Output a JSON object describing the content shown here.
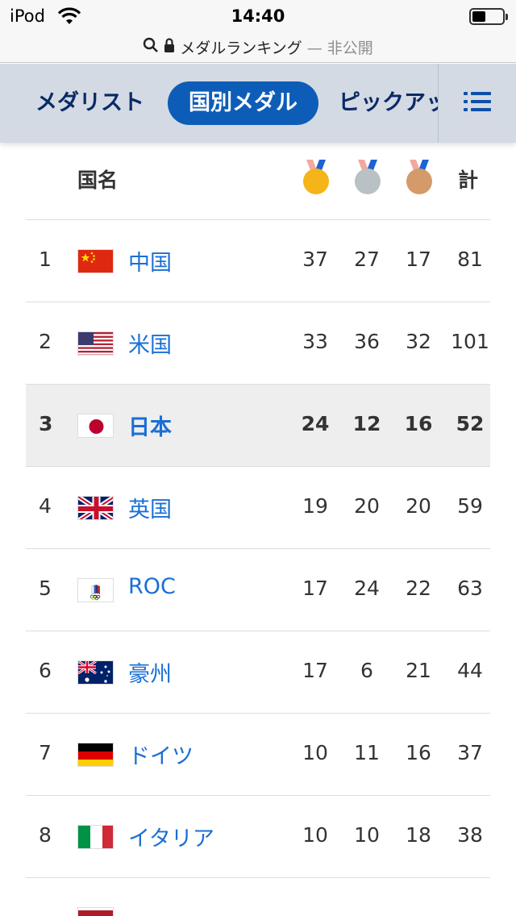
{
  "status_bar": {
    "carrier": "iPod",
    "time": "14:40"
  },
  "url_bar": {
    "title": "メダルランキング",
    "suffix": "— 非公開"
  },
  "tabs": [
    {
      "label": "メダリスト",
      "active": false
    },
    {
      "label": "国別メダル",
      "active": true
    },
    {
      "label": "ピックアップ",
      "active": false
    }
  ],
  "table": {
    "country_header": "国名",
    "total_header": "計",
    "medal_icons": [
      "gold-medal-icon",
      "silver-medal-icon",
      "bronze-medal-icon"
    ],
    "highlight_color": "#eeeeee",
    "link_color": "#1a6fd4",
    "rows": [
      {
        "rank": "1",
        "country": "中国",
        "flag": "china-flag-icon",
        "gold": "37",
        "silver": "27",
        "bronze": "17",
        "total": "81"
      },
      {
        "rank": "2",
        "country": "米国",
        "flag": "usa-flag-icon",
        "gold": "33",
        "silver": "36",
        "bronze": "32",
        "total": "101"
      },
      {
        "rank": "3",
        "country": "日本",
        "flag": "japan-flag-icon",
        "gold": "24",
        "silver": "12",
        "bronze": "16",
        "total": "52",
        "highlighted": true
      },
      {
        "rank": "4",
        "country": "英国",
        "flag": "uk-flag-icon",
        "gold": "19",
        "silver": "20",
        "bronze": "20",
        "total": "59"
      },
      {
        "rank": "5",
        "country": "ROC",
        "flag": "roc-flag-icon",
        "gold": "17",
        "silver": "24",
        "bronze": "22",
        "total": "63"
      },
      {
        "rank": "6",
        "country": "豪州",
        "flag": "australia-flag-icon",
        "gold": "17",
        "silver": "6",
        "bronze": "21",
        "total": "44"
      },
      {
        "rank": "7",
        "country": "ドイツ",
        "flag": "germany-flag-icon",
        "gold": "10",
        "silver": "11",
        "bronze": "16",
        "total": "37"
      },
      {
        "rank": "8",
        "country": "イタリア",
        "flag": "italy-flag-icon",
        "gold": "10",
        "silver": "10",
        "bronze": "18",
        "total": "38"
      }
    ]
  }
}
